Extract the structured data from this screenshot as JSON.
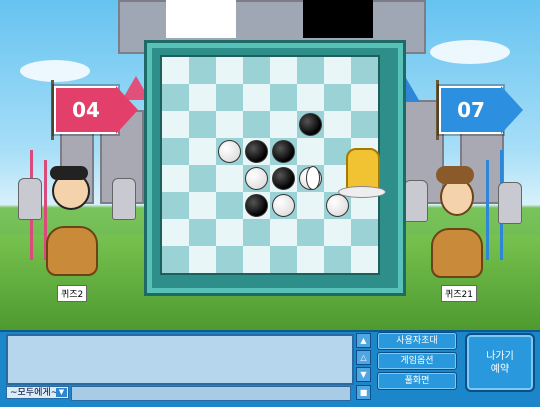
{
  "scores": {
    "left": "04",
    "right": "07"
  },
  "players": {
    "left_name": "퀴즈2",
    "right_name": "퀴즈21"
  },
  "board": {
    "rows": [
      [
        "",
        "",
        "",
        "",
        "",
        "",
        "",
        ""
      ],
      [
        "",
        "",
        "",
        "",
        "",
        "",
        "",
        ""
      ],
      [
        "",
        "",
        "",
        "",
        "",
        "black",
        "",
        ""
      ],
      [
        "",
        "",
        "white",
        "black",
        "black",
        "",
        "",
        ""
      ],
      [
        "",
        "",
        "",
        "white",
        "black",
        "white",
        "",
        ""
      ],
      [
        "",
        "",
        "",
        "black",
        "white",
        "",
        "white",
        ""
      ],
      [
        "",
        "",
        "",
        "",
        "",
        "",
        "",
        ""
      ],
      [
        "",
        "",
        "",
        "",
        "",
        "",
        "",
        ""
      ]
    ]
  },
  "chat": {
    "target": "~모두에게~",
    "dropdown_icon": "triangle-down-icon"
  },
  "menu": {
    "invite": "사용자초대",
    "options": "게임옵션",
    "fullscreen": "풀화면"
  },
  "leave_button": {
    "line1": "나가기",
    "line2": "예약"
  },
  "colors": {
    "left_flag": "#e2406b",
    "right_flag": "#2d8fe0",
    "board": "#2e8f8a"
  }
}
